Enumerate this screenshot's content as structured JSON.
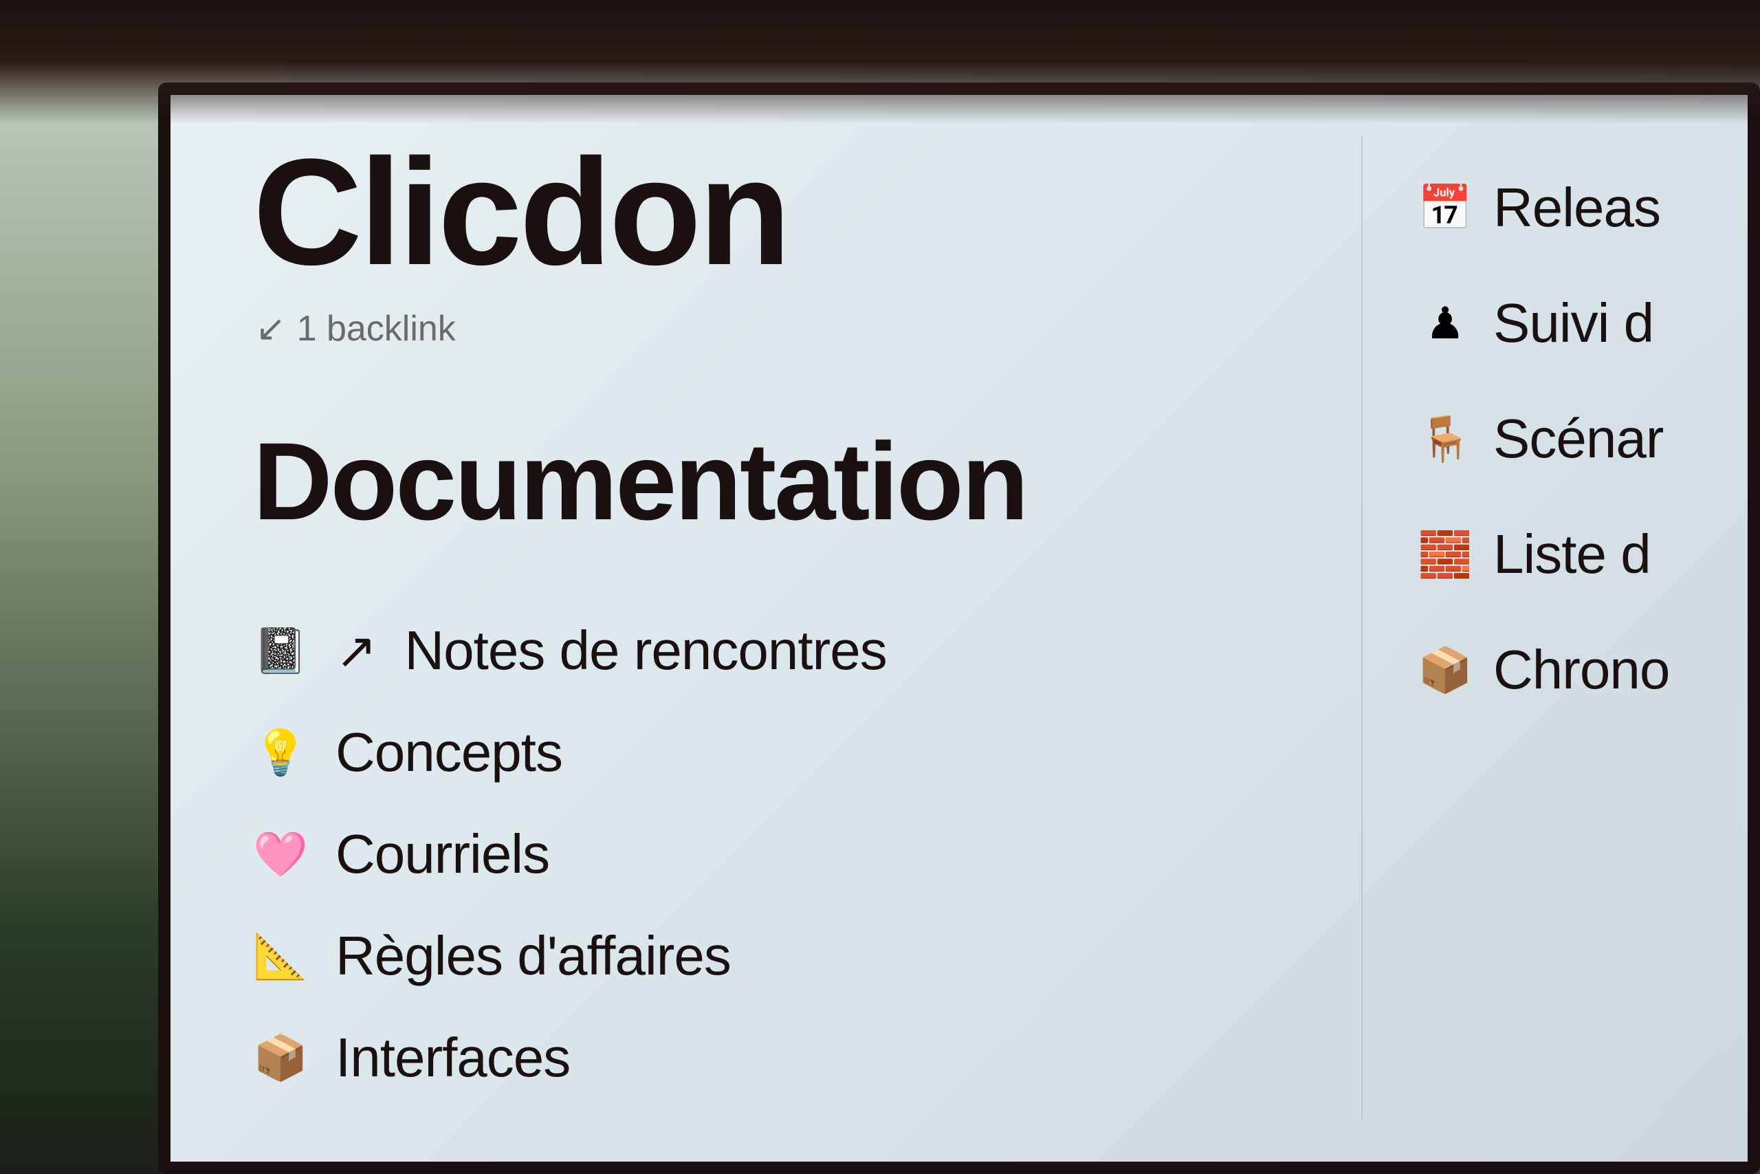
{
  "page": {
    "title": "Clicdon",
    "backlink_icon": "↙",
    "backlink_label": "1 backlink",
    "section_heading": "Documentation"
  },
  "left_items": [
    {
      "id": "notes-rencontres",
      "icon": "📓",
      "arrow": "↗",
      "label": "Notes de rencontres",
      "has_arrow": true
    },
    {
      "id": "concepts",
      "icon": "💡",
      "label": "Concepts",
      "has_arrow": false
    },
    {
      "id": "courriels",
      "icon": "🩷",
      "label": "Courriels",
      "has_arrow": false
    },
    {
      "id": "regles-affaires",
      "icon": "📐",
      "label": "Règles d'affaires",
      "has_arrow": false
    },
    {
      "id": "interfaces",
      "icon": "📦",
      "label": "Interfaces",
      "has_arrow": false
    }
  ],
  "right_items": [
    {
      "id": "release",
      "icon": "📅",
      "label": "Releas"
    },
    {
      "id": "suivi",
      "icon": "♟",
      "label": "Suivi d"
    },
    {
      "id": "scenarios",
      "icon": "🪑",
      "label": "Scénar"
    },
    {
      "id": "liste",
      "icon": "🧱",
      "label": "Liste d"
    },
    {
      "id": "chrono",
      "icon": "📦",
      "label": "Chrono"
    }
  ],
  "colors": {
    "text_primary": "#1a1010",
    "text_secondary": "#6a6a6a",
    "background": "#e4edf0",
    "divider": "#c0c8cc"
  }
}
